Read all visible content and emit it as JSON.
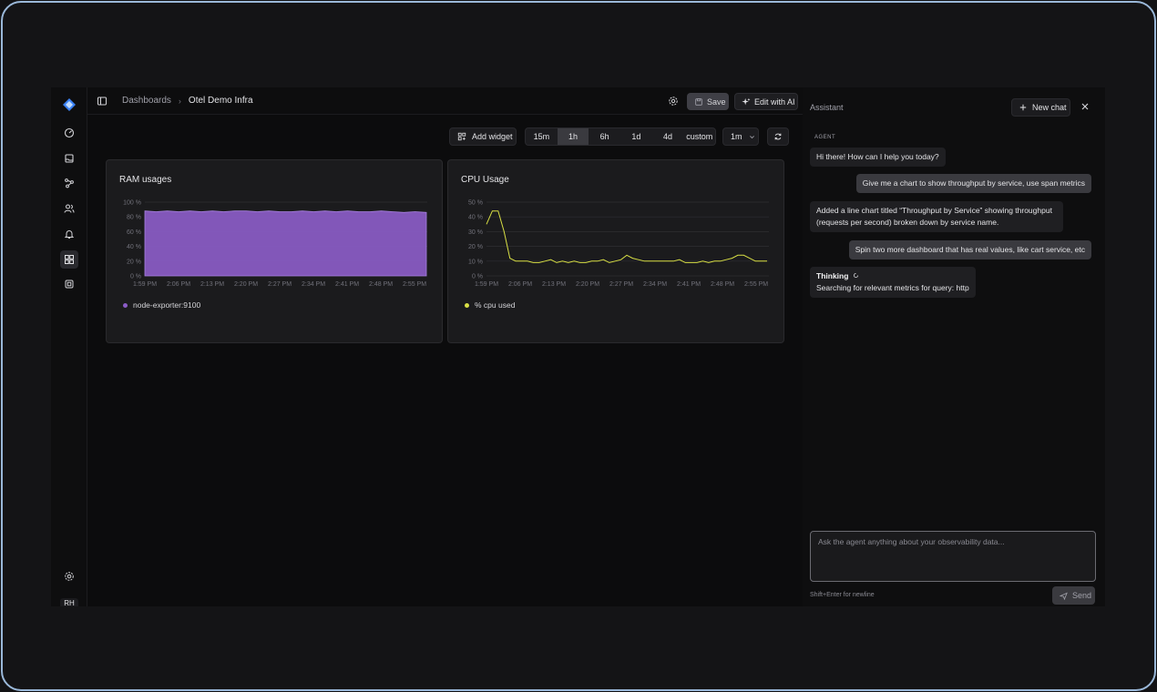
{
  "topbar": {
    "breadcrumb_root": "Dashboards",
    "breadcrumb_current": "Otel Demo Infra",
    "save_label": "Save",
    "edit_ai_label": "Edit with AI"
  },
  "rail": {
    "icons": [
      "logo-icon",
      "gauge-icon",
      "folder-icon",
      "traces-icon",
      "users-icon",
      "bell-icon",
      "dashboards-icon",
      "integrations-icon",
      "settings-icon"
    ],
    "avatar": "RH"
  },
  "toolbar": {
    "add_widget_label": "Add widget",
    "ranges": [
      "15m",
      "1h",
      "6h",
      "1d",
      "4d",
      "custom"
    ],
    "selected_range": "1h",
    "interval": "1m"
  },
  "widgets": [
    {
      "title": "RAM usages",
      "legend": "node-exporter:9100"
    },
    {
      "title": "CPU Usage",
      "legend": "% cpu used"
    }
  ],
  "chart_data": [
    {
      "type": "area",
      "title": "RAM usages",
      "x": [
        "1:59 PM",
        "2:06 PM",
        "2:13 PM",
        "2:20 PM",
        "2:27 PM",
        "2:34 PM",
        "2:41 PM",
        "2:48 PM",
        "2:55 PM"
      ],
      "yticks": [
        "0 %",
        "20 %",
        "40 %",
        "60 %",
        "80 %",
        "100 %"
      ],
      "ylim": [
        0,
        100
      ],
      "series": [
        {
          "name": "node-exporter:9100",
          "color": "#8b5cc7",
          "values": [
            88,
            87,
            88,
            87,
            88,
            87,
            88,
            87,
            88,
            88,
            87,
            88,
            87,
            87,
            88,
            87,
            88,
            87,
            88,
            87,
            87,
            88,
            87,
            86,
            87,
            86
          ]
        }
      ]
    },
    {
      "type": "line",
      "title": "CPU Usage",
      "x": [
        "1:59 PM",
        "2:06 PM",
        "2:13 PM",
        "2:20 PM",
        "2:27 PM",
        "2:34 PM",
        "2:41 PM",
        "2:48 PM",
        "2:55 PM"
      ],
      "yticks": [
        "0 %",
        "10 %",
        "20 %",
        "30 %",
        "40 %",
        "50 %"
      ],
      "ylim": [
        0,
        50
      ],
      "series": [
        {
          "name": "% cpu used",
          "color": "#d9e045",
          "values": [
            35,
            44,
            44,
            30,
            12,
            10,
            10,
            10,
            9,
            9,
            10,
            11,
            9,
            10,
            9,
            10,
            9,
            9,
            10,
            10,
            11,
            9,
            10,
            11,
            14,
            12,
            11,
            10,
            10,
            10,
            10,
            10,
            10,
            11,
            9,
            9,
            9,
            10,
            9,
            10,
            10,
            11,
            12,
            14,
            14,
            12,
            10,
            10,
            10
          ]
        }
      ]
    }
  ],
  "assistant": {
    "header": "Assistant",
    "new_chat_label": "New chat",
    "agent_tag": "AGENT",
    "messages": [
      {
        "role": "agent",
        "text": "Hi there! How can I help you today?"
      },
      {
        "role": "user",
        "text": "Give me a chart to show throughput by service, use span metrics"
      },
      {
        "role": "agent",
        "text": "Added a line chart titled “Throughput by Service” showing throughput (requests per second) broken down by service name."
      },
      {
        "role": "user",
        "text": "Spin two more dashboard that has real values, like cart service, etc"
      }
    ],
    "thinking_title": "Thinking",
    "thinking_text": "Searching for relevant metrics for query: http",
    "composer_placeholder": "Ask the agent anything about your observability data...",
    "hint": "Shift+Enter for newline",
    "send_label": "Send"
  }
}
